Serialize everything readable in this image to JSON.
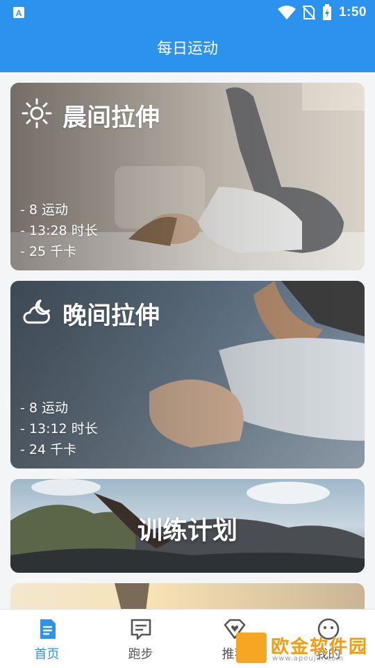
{
  "status_bar": {
    "time": "1:50"
  },
  "app_bar": {
    "title": "每日运动"
  },
  "cards": [
    {
      "title": "晨间拉伸",
      "icon": "sun-icon",
      "stats": [
        "- 8 运动",
        "- 13:28 时长",
        "- 25 千卡"
      ]
    },
    {
      "title": "晚间拉伸",
      "icon": "moon-cloud-icon",
      "stats": [
        "- 8 运动",
        "- 13:12 时长",
        "- 24 千卡"
      ]
    }
  ],
  "plan_card": {
    "title": "训练计划"
  },
  "bottom_nav": [
    {
      "label": "首页",
      "icon": "document-icon",
      "active": true
    },
    {
      "label": "跑步",
      "icon": "message-icon",
      "active": false
    },
    {
      "label": "推荐",
      "icon": "diamond-heart-icon",
      "active": false
    },
    {
      "label": "我的",
      "icon": "smiley-icon",
      "active": false
    }
  ],
  "watermark": {
    "text": "欧金软件园",
    "url": "www.apoujin.com"
  },
  "colors": {
    "primary": "#2b92ee",
    "nav_inactive": "#555555"
  }
}
